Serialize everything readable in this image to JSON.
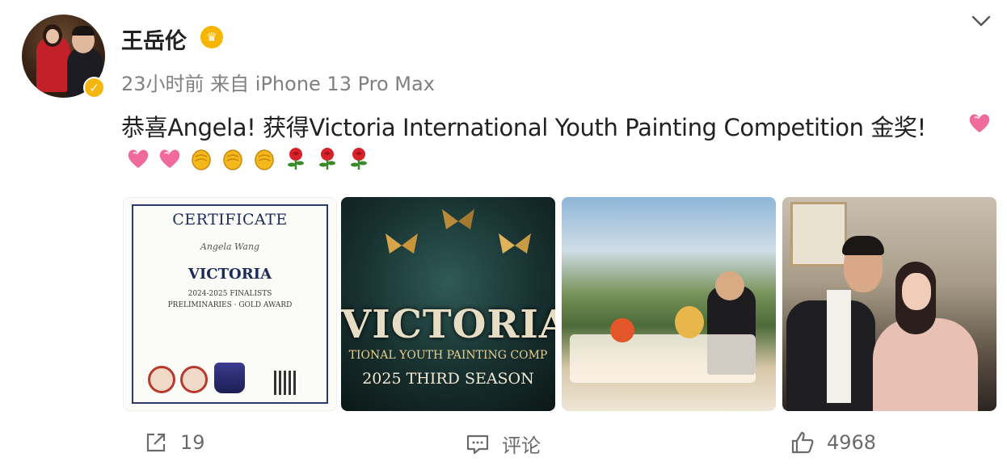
{
  "user": {
    "name": "王岳伦",
    "badge_icon": "crown-icon",
    "verified_color": "#f5b60f"
  },
  "meta": "23小时前 来自 iPhone 13 Pro Max",
  "post": {
    "text": "恭喜Angela! 获得Victoria International Youth Painting Competition 金奖!",
    "emojis": [
      "heart-emoji",
      "heart-emoji",
      "clap-emoji",
      "clap-emoji",
      "clap-emoji",
      "rose-emoji",
      "rose-emoji",
      "rose-emoji"
    ]
  },
  "images": {
    "certificate": {
      "title": "CERTIFICATE",
      "name": "Angela Wang",
      "victoria": "VICTORIA",
      "line1": "2024-2025 FINALISTS",
      "line2": "PRELIMINARIES · GOLD AWARD"
    },
    "poster": {
      "title": "VICTORIA",
      "subtitle": "TIONAL YOUTH PAINTING COMP",
      "season": "2025 THIRD SEASON"
    }
  },
  "actions": {
    "share_count": "19",
    "comment_label": "评论",
    "like_count": "4968"
  }
}
